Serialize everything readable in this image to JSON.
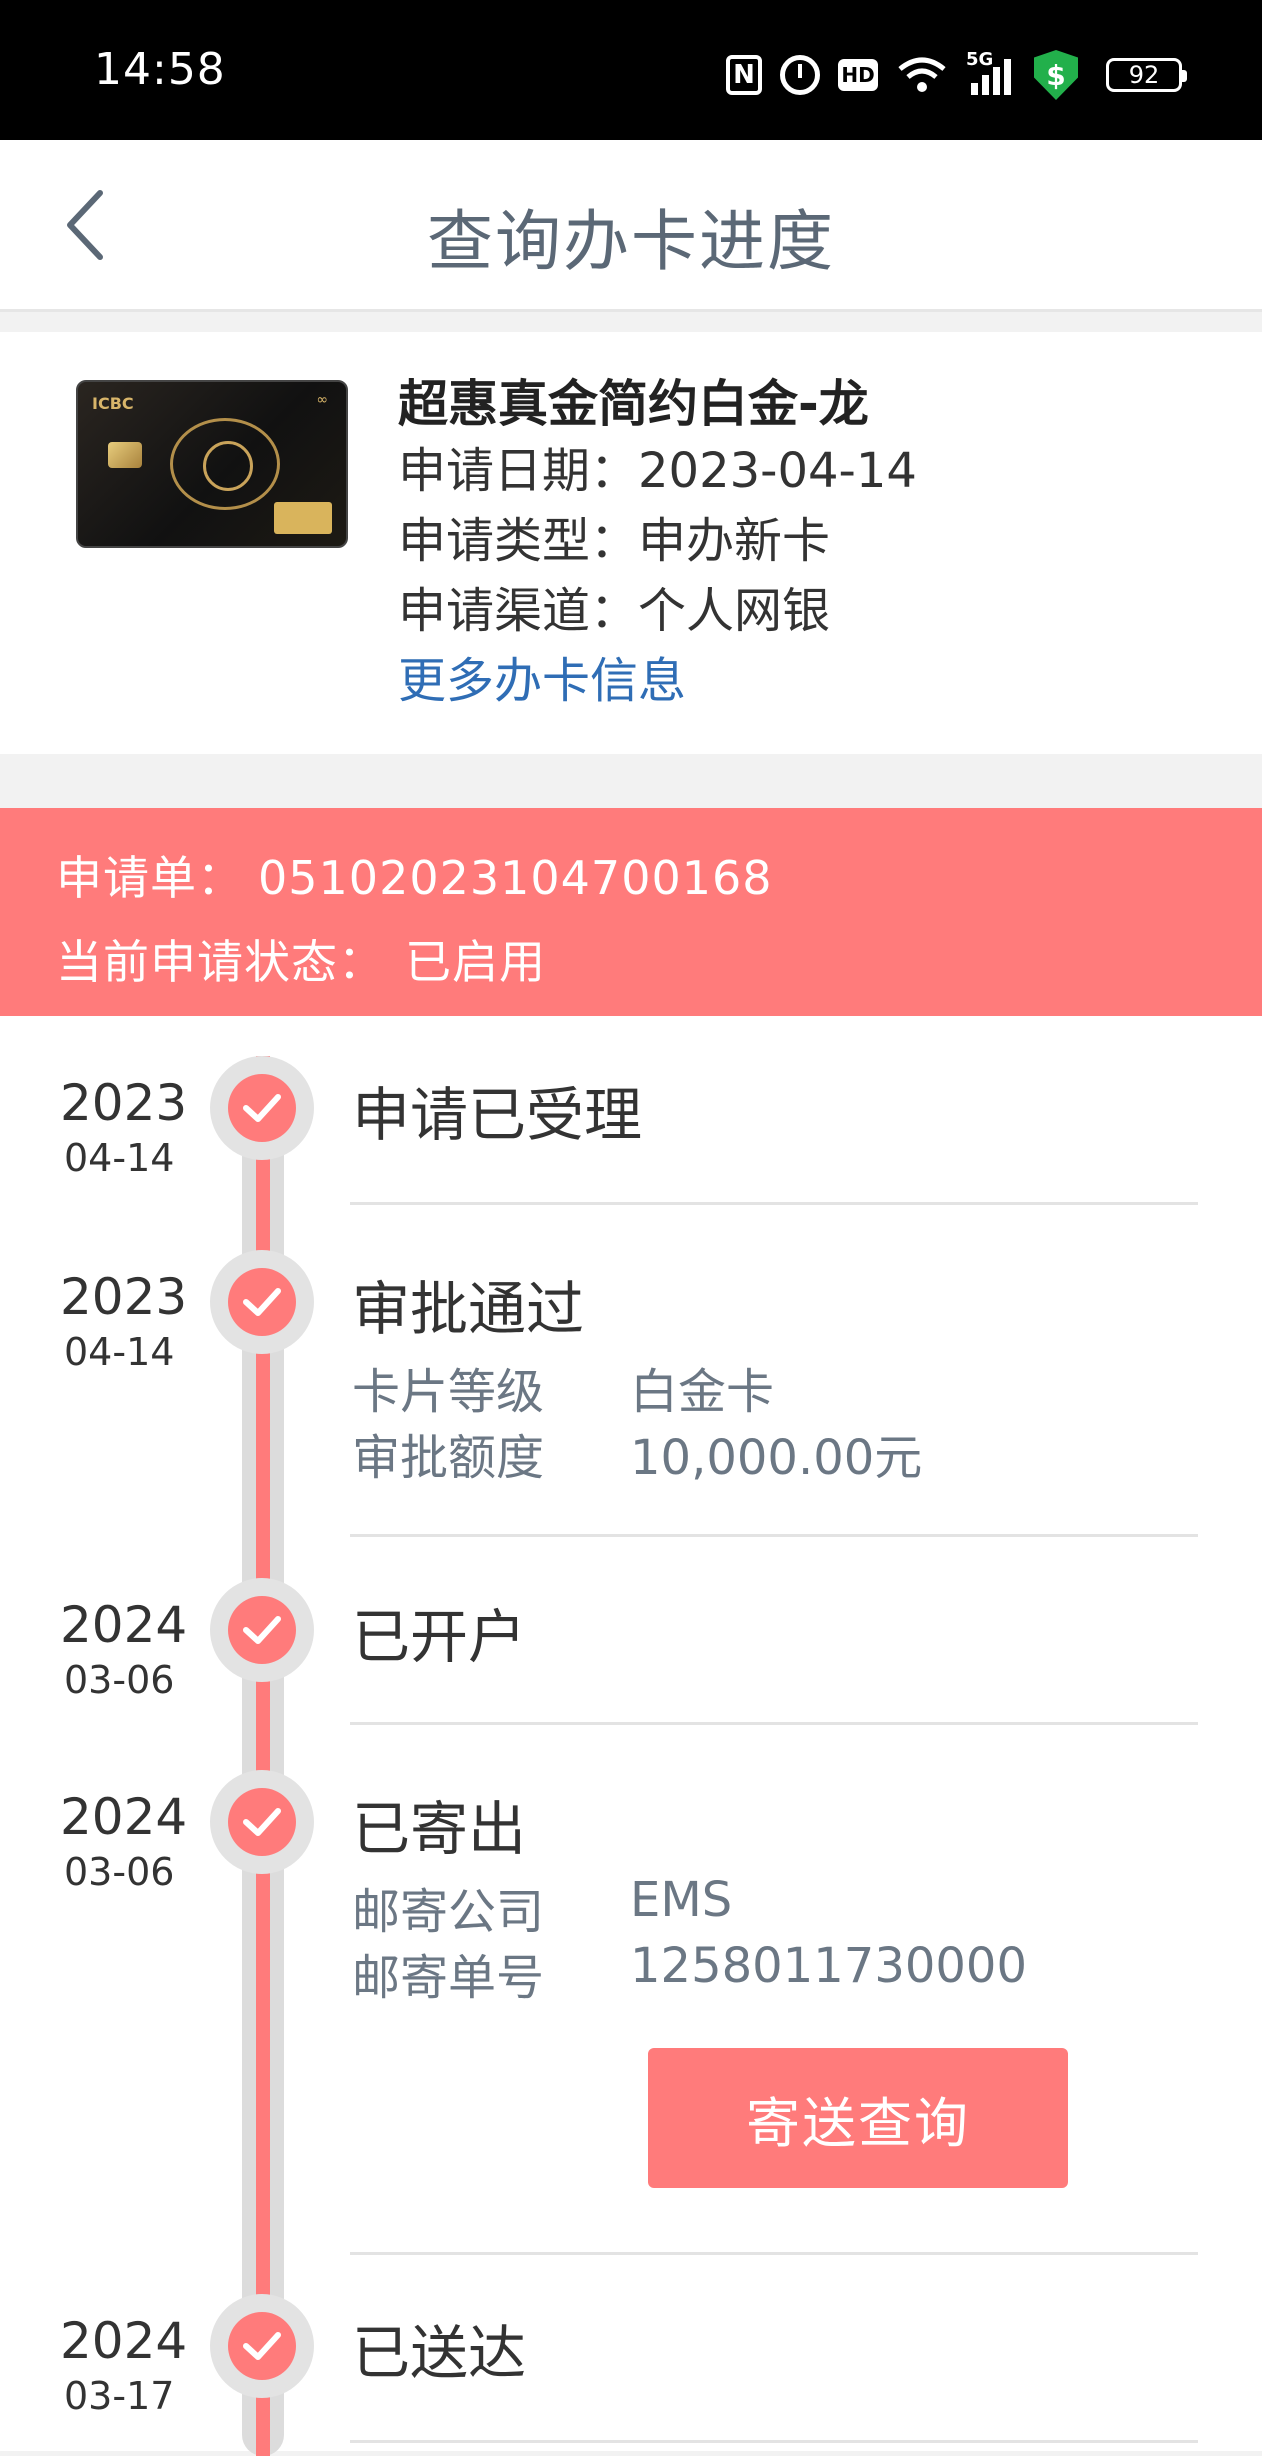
{
  "status_bar": {
    "time": "14:58",
    "battery": "92",
    "icons": [
      "nfc-icon",
      "alarm-icon",
      "hd-icon",
      "wifi-icon",
      "5g-signal-icon",
      "security-shield-icon",
      "battery-icon"
    ],
    "hd_label": "HD",
    "network_label": "5G",
    "nfc_label": "N",
    "shield_label": "$"
  },
  "header": {
    "title": "查询办卡进度",
    "back_icon": "chevron-left-icon"
  },
  "card": {
    "name": "超惠真金简约白金-龙",
    "apply_date": "申请日期：2023-04-14",
    "apply_type": "申请类型：申办新卡",
    "apply_channel": "申请渠道：个人网银",
    "more_link": "更多办卡信息",
    "card_brand": "ICBC"
  },
  "application": {
    "number_label": "申请单：",
    "number_value": "05102023104700168",
    "status_label": "当前申请状态：",
    "status_value": "已启用",
    "accent_color": "#ff7b7b"
  },
  "timeline": {
    "steps": [
      {
        "year": "2023",
        "date": "04-14",
        "title": "申请已受理"
      },
      {
        "year": "2023",
        "date": "04-14",
        "title": "审批通过",
        "details": [
          {
            "label": "卡片等级",
            "value": "白金卡"
          },
          {
            "label": "审批额度",
            "value": "10,000.00元"
          }
        ]
      },
      {
        "year": "2024",
        "date": "03-06",
        "title": "已开户"
      },
      {
        "year": "2024",
        "date": "03-06",
        "title": "已寄出",
        "details": [
          {
            "label": "邮寄公司",
            "value": "EMS"
          },
          {
            "label": "邮寄单号",
            "value": "1258011730000"
          }
        ],
        "button": "寄送查询"
      },
      {
        "year": "2024",
        "date": "03-17",
        "title": "已送达"
      }
    ]
  }
}
